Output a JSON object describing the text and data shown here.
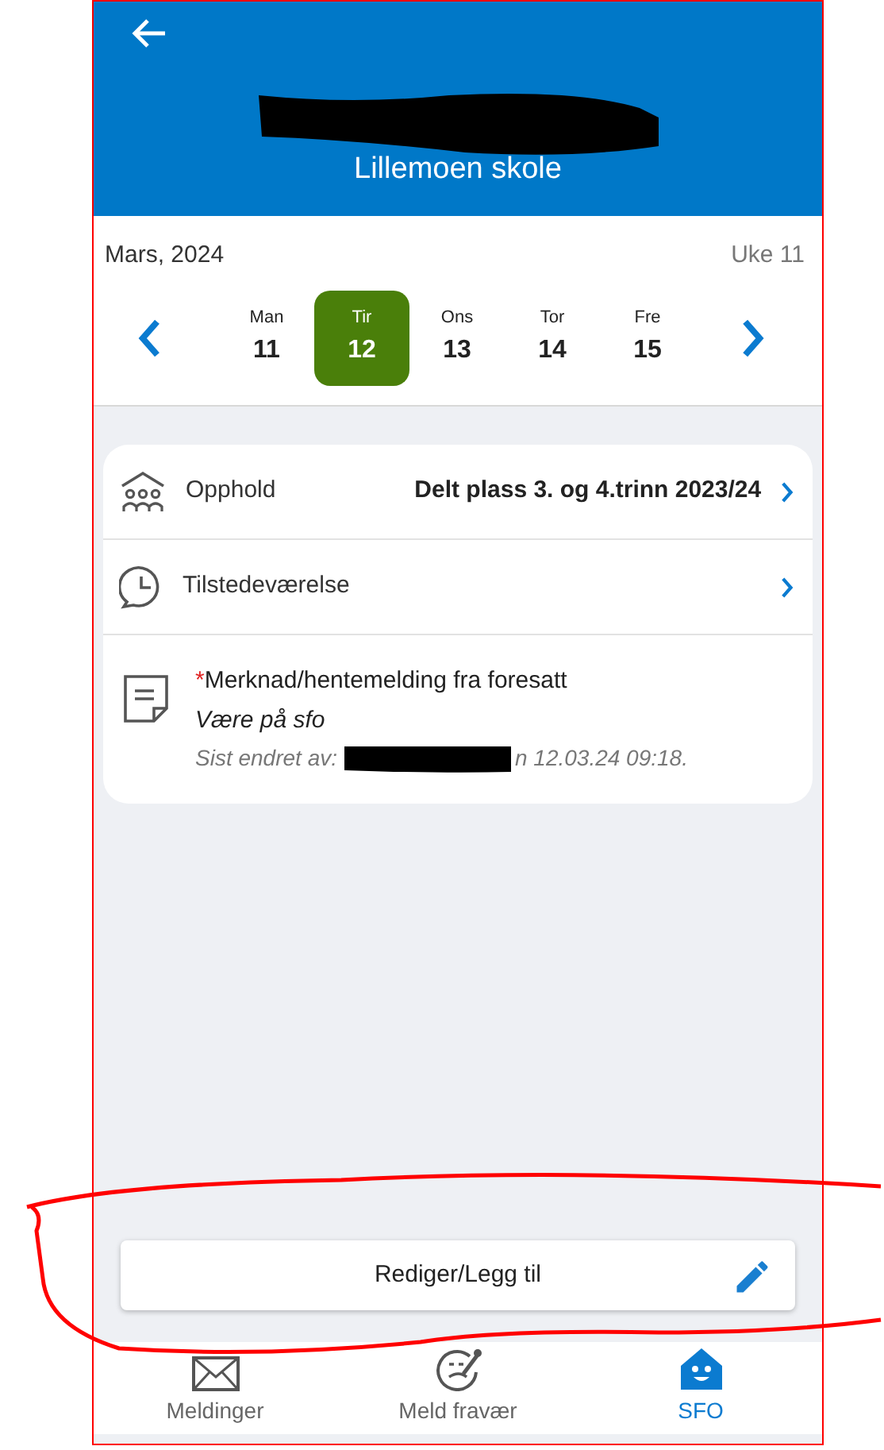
{
  "header": {
    "school": "Lillemoen skole"
  },
  "calendar": {
    "month": "Mars, 2024",
    "week": "Uke 11",
    "days": [
      {
        "weekday": "Man",
        "date": "11",
        "selected": false
      },
      {
        "weekday": "Tir",
        "date": "12",
        "selected": true
      },
      {
        "weekday": "Ons",
        "date": "13",
        "selected": false
      },
      {
        "weekday": "Tor",
        "date": "14",
        "selected": false
      },
      {
        "weekday": "Fre",
        "date": "15",
        "selected": false
      }
    ]
  },
  "card": {
    "rows": [
      {
        "kind": "stay",
        "label": "Opphold",
        "value": "Delt plass 3. og 4.trinn 2023/24"
      },
      {
        "kind": "attendance",
        "label": "Tilstedeværelse"
      }
    ],
    "note": {
      "required_mark": "*",
      "title": "Merknad/hentemelding fra foresatt",
      "text": "Være på sfo",
      "edited_prefix": "Sist endret av:",
      "edited_suffix": "n 12.03.24 09:18."
    }
  },
  "edit_button": {
    "label": "Rediger/Legg til"
  },
  "bottom_nav": [
    {
      "kind": "messages",
      "label": "Meldinger",
      "selected": false
    },
    {
      "kind": "absence",
      "label": "Meld fravær",
      "selected": false
    },
    {
      "kind": "sfo",
      "label": "SFO",
      "selected": true
    }
  ]
}
